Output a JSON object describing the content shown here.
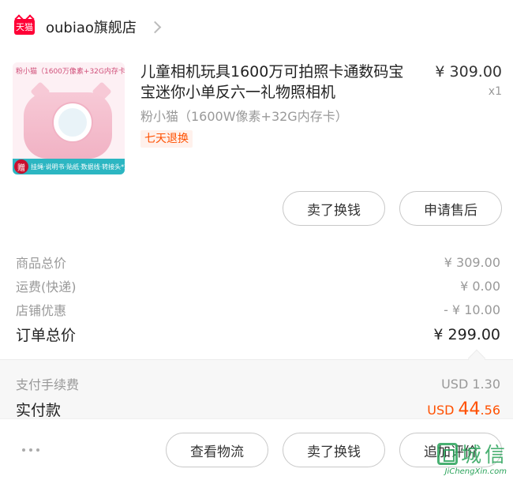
{
  "store": {
    "badge": "天猫",
    "name": "oubiao旗舰店"
  },
  "product": {
    "image_caption": "粉小猫（1600万像素+32G内存卡）",
    "image_ribbon_badge": "赠",
    "image_ribbon_text": "挂绳·说明书·贴纸·数据线·转接头*2",
    "title": "儿童相机玩具1600万可拍照卡通数码宝宝迷你小单反六一礼物照相机",
    "sku": "粉小猫（1600W像素+32G内存卡）",
    "return_tag": "七天退换",
    "price": "¥ 309.00",
    "qty": "x1"
  },
  "item_actions": {
    "sell": "卖了换钱",
    "after_sale": "申请售后"
  },
  "summary": {
    "subtotal_label": "商品总价",
    "subtotal_value": "¥ 309.00",
    "shipping_label": "运费(快递)",
    "shipping_value": "¥ 0.00",
    "discount_label": "店铺优惠",
    "discount_value": "- ¥ 10.00",
    "total_label": "订单总价",
    "total_value": "¥ 299.00"
  },
  "payment": {
    "fee_label": "支付手续费",
    "fee_value": "USD 1.30",
    "paid_label": "实付款",
    "paid_currency": "USD",
    "paid_int": "44",
    "paid_dec": ".56"
  },
  "bottom_bar": {
    "logistics": "查看物流",
    "sell": "卖了换钱",
    "review": "追加评价"
  },
  "watermark": {
    "text": "城信",
    "url": "JiChengXin.com"
  },
  "colors": {
    "tmall_red": "#ff0036",
    "accent_orange": "#ff5000",
    "watermark_green": "#2aa35a"
  }
}
